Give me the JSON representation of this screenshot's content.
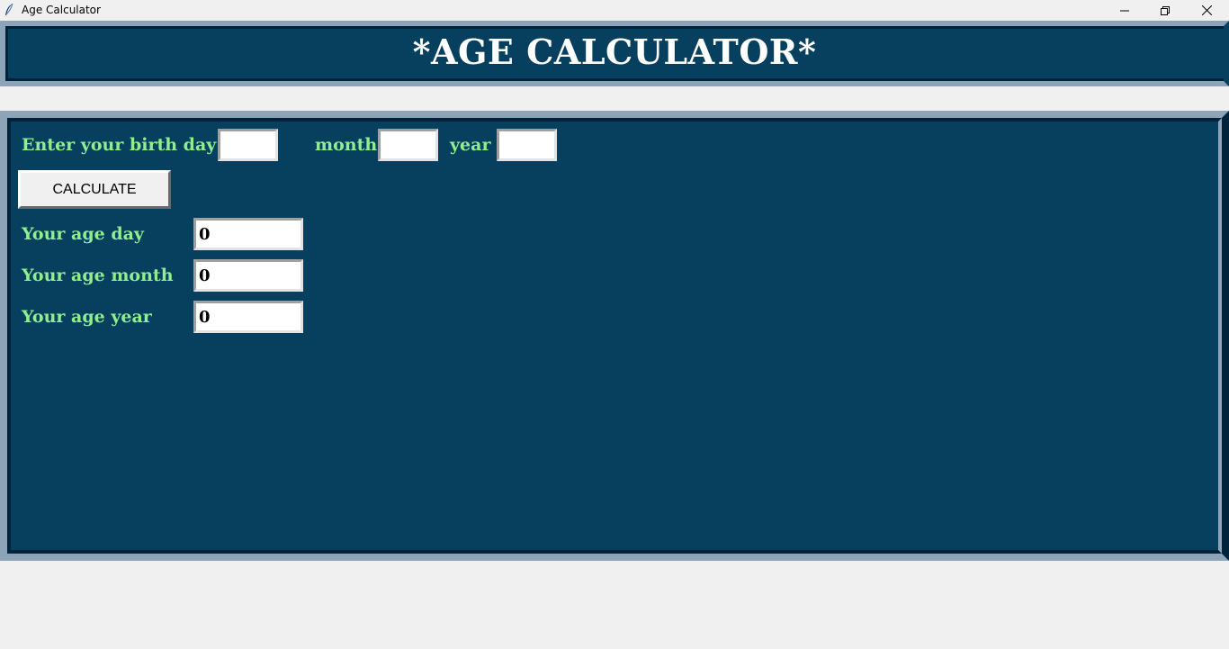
{
  "window": {
    "title": "Age Calculator",
    "icon": "feather-icon",
    "controls": [
      "minimize-icon",
      "restore-icon",
      "close-icon"
    ]
  },
  "header": {
    "title": "*AGE CALCULATOR*"
  },
  "birth": {
    "day_label": "Enter your birth day",
    "day_value": "",
    "month_label": "month",
    "month_value": "",
    "year_label": "year",
    "year_value": ""
  },
  "actions": {
    "calculate_label": "CALCULATE"
  },
  "results": {
    "day_label": "Your age day",
    "day_value": "0",
    "month_label": "Your age month",
    "month_value": "0",
    "year_label": "Your age year",
    "year_value": "0"
  },
  "colors": {
    "panel_bg": "#07405f",
    "label_text": "#90ee90",
    "title_text": "#ffffff",
    "frame_light": "#8da3b7",
    "frame_dark": "#00223a"
  }
}
